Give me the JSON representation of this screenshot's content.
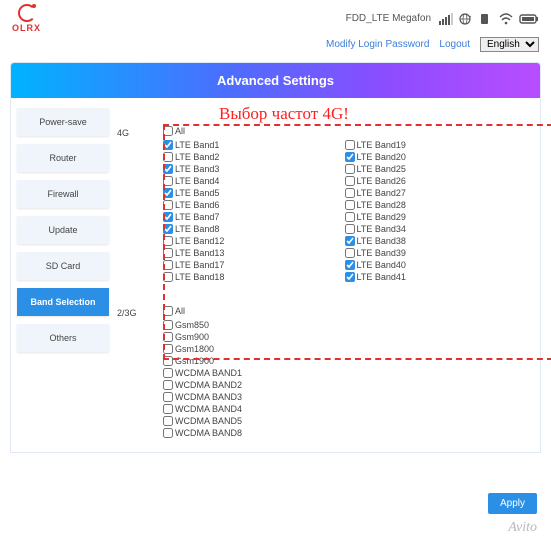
{
  "brand": "OLRX",
  "status_text": "FDD_LTE   Megafon",
  "signal_icon": "signal-bars-icon",
  "globe_icon": "globe-icon",
  "sim_icon": "sim-icon",
  "wifi_icon": "wifi-icon",
  "battery_icon": "battery-icon",
  "subheader": {
    "modify": "Modify Login Password",
    "logout": "Logout",
    "lang": "English"
  },
  "banner": "Advanced Settings",
  "callout": "Выбор частот 4G!",
  "sidebar": [
    {
      "label": "Power-save",
      "active": false
    },
    {
      "label": "Router",
      "active": false
    },
    {
      "label": "Firewall",
      "active": false
    },
    {
      "label": "Update",
      "active": false
    },
    {
      "label": "SD Card",
      "active": false
    },
    {
      "label": "Band Selection",
      "active": true
    },
    {
      "label": "Others",
      "active": false
    }
  ],
  "groups": {
    "g4": {
      "label": "4G",
      "all": "All",
      "col1": [
        {
          "label": "LTE Band1",
          "checked": true
        },
        {
          "label": "LTE Band2",
          "checked": false
        },
        {
          "label": "LTE Band3",
          "checked": true
        },
        {
          "label": "LTE Band4",
          "checked": false
        },
        {
          "label": "LTE Band5",
          "checked": true
        },
        {
          "label": "LTE Band6",
          "checked": false
        },
        {
          "label": "LTE Band7",
          "checked": true
        },
        {
          "label": "LTE Band8",
          "checked": true
        },
        {
          "label": "LTE Band12",
          "checked": false
        },
        {
          "label": "LTE Band13",
          "checked": false
        },
        {
          "label": "LTE Band17",
          "checked": false
        },
        {
          "label": "LTE Band18",
          "checked": false
        }
      ],
      "col2": [
        {
          "label": "LTE Band19",
          "checked": false
        },
        {
          "label": "LTE Band20",
          "checked": true
        },
        {
          "label": "LTE Band25",
          "checked": false
        },
        {
          "label": "LTE Band26",
          "checked": false
        },
        {
          "label": "LTE Band27",
          "checked": false
        },
        {
          "label": "LTE Band28",
          "checked": false
        },
        {
          "label": "LTE Band29",
          "checked": false
        },
        {
          "label": "LTE Band34",
          "checked": false
        },
        {
          "label": "LTE Band38",
          "checked": true
        },
        {
          "label": "LTE Band39",
          "checked": false
        },
        {
          "label": "LTE Band40",
          "checked": true
        },
        {
          "label": "LTE Band41",
          "checked": true
        }
      ]
    },
    "g23": {
      "label": "2/3G",
      "all": "All",
      "items": [
        {
          "label": "Gsm850",
          "checked": false
        },
        {
          "label": "Gsm900",
          "checked": false
        },
        {
          "label": "Gsm1800",
          "checked": false
        },
        {
          "label": "Gsm1900",
          "checked": false
        },
        {
          "label": "WCDMA BAND1",
          "checked": false
        },
        {
          "label": "WCDMA BAND2",
          "checked": false
        },
        {
          "label": "WCDMA BAND3",
          "checked": false
        },
        {
          "label": "WCDMA BAND4",
          "checked": false
        },
        {
          "label": "WCDMA BAND5",
          "checked": false
        },
        {
          "label": "WCDMA BAND8",
          "checked": false
        }
      ]
    }
  },
  "apply": "Apply",
  "watermark": "Avito"
}
